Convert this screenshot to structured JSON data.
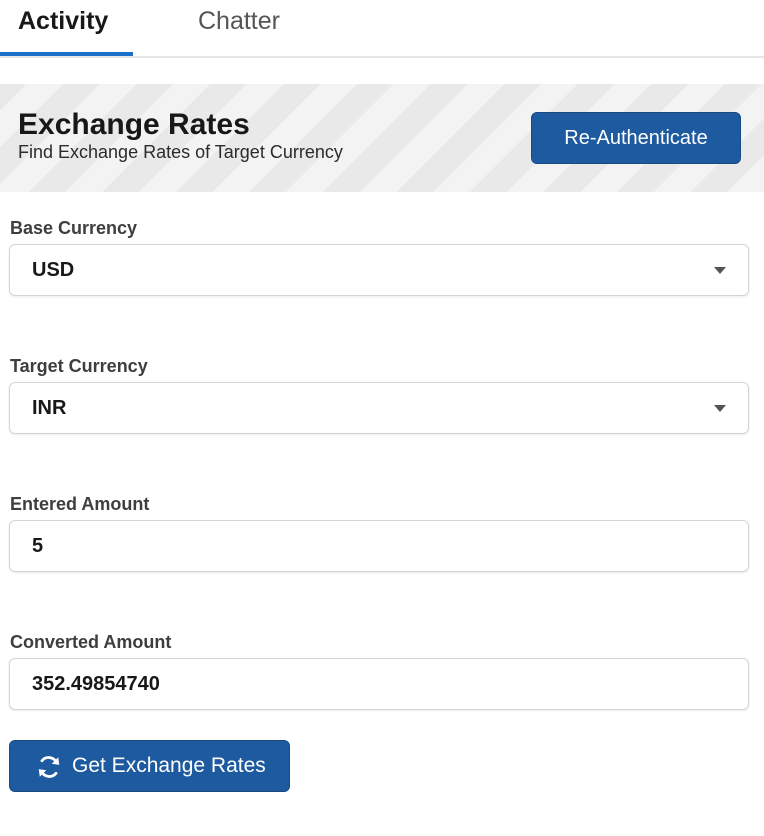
{
  "tabs": [
    {
      "label": "Activity",
      "active": true
    },
    {
      "label": "Chatter",
      "active": false
    }
  ],
  "header": {
    "title": "Exchange Rates",
    "subtitle": "Find Exchange Rates of Target Currency",
    "reauth_label": "Re-Authenticate"
  },
  "form": {
    "base_currency": {
      "label": "Base Currency",
      "value": "USD"
    },
    "target_currency": {
      "label": "Target Currency",
      "value": "INR"
    },
    "entered_amount": {
      "label": "Entered Amount",
      "value": "5"
    },
    "converted_amount": {
      "label": "Converted Amount",
      "value": "352.49854740"
    },
    "submit_label": "Get Exchange Rates",
    "submit_icon": "refresh-icon"
  },
  "colors": {
    "accent": "#1d5aa0",
    "tab_indicator": "#1b6fc9"
  }
}
